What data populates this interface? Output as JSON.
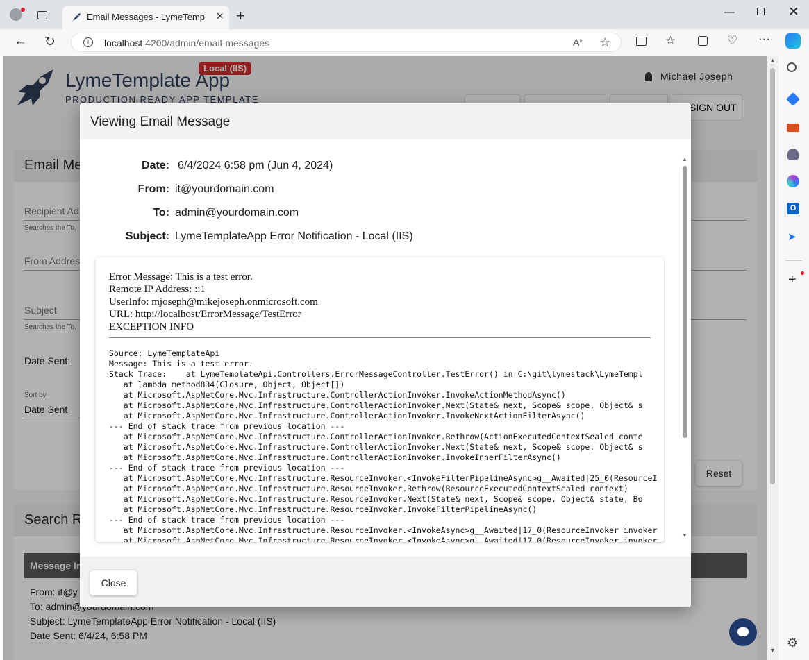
{
  "browser": {
    "tab_title": "Email Messages - LymeTemplate",
    "url_host": "localhost",
    "url_path": ":4200/admin/email-messages"
  },
  "app": {
    "name": "LymeTemplate App",
    "env_badge": "Local (IIS)",
    "tagline": "PRODUCTION READY APP TEMPLATE",
    "user": "Michael Joseph",
    "signout_label": "SIGN OUT"
  },
  "background": {
    "section_title": "Email Me",
    "recipient_label": "Recipient Ad",
    "recipient_hint": "Searches the To,",
    "from_label": "From Addres",
    "subject_label": "Subject",
    "subject_hint": "Searches the To,",
    "date_sent_label": "Date Sent:",
    "sort_label": "Sort by",
    "sort_value": "Date Sent",
    "reset_label": "Reset",
    "results_title": "Search R",
    "table_header": "Message In",
    "result": {
      "from": "From: it@y",
      "to": "To: admin@yourdomain.com",
      "subject": "Subject: LymeTemplateApp Error Notification - Local (IIS)",
      "date_sent": "Date Sent: 6/4/24, 6:58 PM"
    }
  },
  "modal": {
    "title": "Viewing Email Message",
    "date_label": "Date:",
    "date_value": "6/4/2024 6:58 pm (Jun 4, 2024)",
    "from_label": "From:",
    "from_value": "it@yourdomain.com",
    "to_label": "To:",
    "to_value": "admin@yourdomain.com",
    "subject_label": "Subject:",
    "subject_value": "LymeTemplateApp Error Notification - Local (IIS)",
    "body": {
      "error_message": "Error Message: This is a test error.",
      "remote_ip": "Remote IP Address: ::1",
      "user_info": "UserInfo: mjoseph@mikejoseph.onmicrosoft.com",
      "url": "URL: http://localhost/ErrorMessage/TestError",
      "exception_info": "EXCEPTION INFO",
      "trace": "Source: LymeTemplateApi\nMessage: This is a test error.\nStack Trace:    at LymeTemplateApi.Controllers.ErrorMessageController.TestError() in C:\\git\\lymestack\\LymeTempl\n   at lambda_method834(Closure, Object, Object[])\n   at Microsoft.AspNetCore.Mvc.Infrastructure.ControllerActionInvoker.InvokeActionMethodAsync()\n   at Microsoft.AspNetCore.Mvc.Infrastructure.ControllerActionInvoker.Next(State& next, Scope& scope, Object& s\n   at Microsoft.AspNetCore.Mvc.Infrastructure.ControllerActionInvoker.InvokeNextActionFilterAsync()\n--- End of stack trace from previous location ---\n   at Microsoft.AspNetCore.Mvc.Infrastructure.ControllerActionInvoker.Rethrow(ActionExecutedContextSealed conte\n   at Microsoft.AspNetCore.Mvc.Infrastructure.ControllerActionInvoker.Next(State& next, Scope& scope, Object& s\n   at Microsoft.AspNetCore.Mvc.Infrastructure.ControllerActionInvoker.InvokeInnerFilterAsync()\n--- End of stack trace from previous location ---\n   at Microsoft.AspNetCore.Mvc.Infrastructure.ResourceInvoker.<InvokeFilterPipelineAsync>g__Awaited|25_0(ResourceInvoker invoker, Task las\n   at Microsoft.AspNetCore.Mvc.Infrastructure.ResourceInvoker.Rethrow(ResourceExecutedContextSealed context)\n   at Microsoft.AspNetCore.Mvc.Infrastructure.ResourceInvoker.Next(State& next, Scope& scope, Object& state, Bo\n   at Microsoft.AspNetCore.Mvc.Infrastructure.ResourceInvoker.InvokeFilterPipelineAsync()\n--- End of stack trace from previous location ---\n   at Microsoft.AspNetCore.Mvc.Infrastructure.ResourceInvoker.<InvokeAsync>g__Awaited|17_0(ResourceInvoker invoker, Task tas\n   at Microsoft.AspNetCore.Mvc.Infrastructure.ResourceInvoker.<InvokeAsync>g__Awaited|17_0(ResourceInvoker invoker, Task tas"
    },
    "close_label": "Close"
  },
  "colors": {
    "brand": "#2f3e5a",
    "badge": "#d32f2f",
    "table_header": "#5a5a5a"
  }
}
